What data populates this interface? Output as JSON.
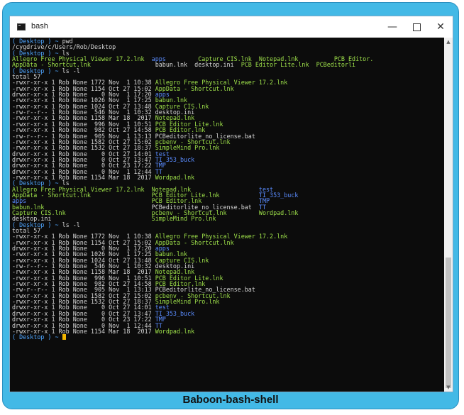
{
  "window": {
    "title": "bash",
    "minimize_glyph": "—",
    "close_glyph": "✕"
  },
  "icons": {
    "app_icon": "terminal-icon",
    "scroll_up": "chevron-up-icon",
    "scroll_down": "chevron-down-icon"
  },
  "scroll": {
    "up_glyph": "▲",
    "down_glyph": "▼",
    "position_fraction": 0.62
  },
  "caption": "Baboon-bash-shell",
  "colors": {
    "frame": "#43b9e6",
    "terminal_bg": "#0c0c0c",
    "prompt": "#4fa6ff",
    "executable": "#9fe24a",
    "directory": "#5a8cff",
    "text": "#d7d7d7",
    "cursor": "#f2b500"
  },
  "terminal": {
    "lines": [
      [
        {
          "t": "( Desktop ) ~ ",
          "c": "prompt"
        },
        {
          "t": "pwd",
          "c": "cmd"
        }
      ],
      [
        {
          "t": "/cygdrive/c/Users/Rob/Desktop",
          "c": "plain"
        }
      ],
      [
        {
          "t": "( Desktop ) ~ ",
          "c": "prompt"
        },
        {
          "t": "ls",
          "c": "cmd"
        }
      ],
      [
        {
          "t": "Allegro Free Physical Viewer 17.2.lnk  ",
          "c": "exe"
        },
        {
          "t": "apps         ",
          "c": "dir"
        },
        {
          "t": "Capture CIS.lnk  Notepad.lnk          PCB Editor.",
          "c": "exe"
        }
      ],
      [
        {
          "t": "AppData - Shortcut.lnk                  ",
          "c": "exe"
        },
        {
          "t": "babun.lnk  desktop.ini  ",
          "c": "plain"
        },
        {
          "t": "PCB Editor Lite.lnk  PCBeditorli",
          "c": "exe"
        }
      ],
      [
        {
          "t": "( Desktop ) ~ ",
          "c": "prompt"
        },
        {
          "t": "ls -l",
          "c": "cmd"
        }
      ],
      [
        {
          "t": "total 57",
          "c": "plain"
        }
      ],
      [
        {
          "t": "-rwxr-xr-x 1 Rob None 1772 Nov  1 10:38 ",
          "c": "plain"
        },
        {
          "t": "Allegro Free Physical Viewer 17.2.lnk",
          "c": "exe"
        }
      ],
      [
        {
          "t": "-rwxr-xr-x 1 Rob None 1154 Oct 27 15:02 ",
          "c": "plain"
        },
        {
          "t": "AppData - Shortcut.lnk",
          "c": "exe"
        }
      ],
      [
        {
          "t": "drwxr-xr-x 1 Rob None    0 Nov  1 17:20 ",
          "c": "plain"
        },
        {
          "t": "apps",
          "c": "dir"
        }
      ],
      [
        {
          "t": "-rwxr-xr-x 1 Rob None 1026 Nov  1 17:25 ",
          "c": "plain"
        },
        {
          "t": "babun.lnk",
          "c": "exe"
        }
      ],
      [
        {
          "t": "-rwxr-xr-x 1 Rob None 1024 Oct 27 13:48 ",
          "c": "plain"
        },
        {
          "t": "Capture CIS.lnk",
          "c": "exe"
        }
      ],
      [
        {
          "t": "-rw-r--r-- 1 Rob None  546 Nov  1 10:32 desktop.ini",
          "c": "plain"
        }
      ],
      [
        {
          "t": "-rwxr-xr-x 1 Rob None 1158 Mar 18  2017 ",
          "c": "plain"
        },
        {
          "t": "Notepad.lnk",
          "c": "exe"
        }
      ],
      [
        {
          "t": "-rwxr-xr-x 1 Rob None  996 Nov  1 10:51 ",
          "c": "plain"
        },
        {
          "t": "PCB Editor Lite.lnk",
          "c": "exe"
        }
      ],
      [
        {
          "t": "-rwxr-xr-x 1 Rob None  982 Oct 27 14:58 ",
          "c": "plain"
        },
        {
          "t": "PCB Editor.lnk",
          "c": "exe"
        }
      ],
      [
        {
          "t": "-rw-r--r-- 1 Rob None  905 Nov  1 13:13 PCBeditorlite_no_license.bat",
          "c": "plain"
        }
      ],
      [
        {
          "t": "-rwxr-xr-x 1 Rob None 1582 Oct 27 15:02 ",
          "c": "plain"
        },
        {
          "t": "pcbenv - Shortcut.lnk",
          "c": "exe"
        }
      ],
      [
        {
          "t": "-rwxr-xr-x 1 Rob None 1532 Oct 27 18:37 ",
          "c": "plain"
        },
        {
          "t": "SimpleMind Pro.lnk",
          "c": "exe"
        }
      ],
      [
        {
          "t": "drwxr-xr-x 1 Rob None    0 Oct 27 14:01 ",
          "c": "plain"
        },
        {
          "t": "test",
          "c": "dir"
        }
      ],
      [
        {
          "t": "drwxr-xr-x 1 Rob None    0 Oct 27 13:47 ",
          "c": "plain"
        },
        {
          "t": "TI_353_buck",
          "c": "dir"
        }
      ],
      [
        {
          "t": "drwxr-xr-x 1 Rob None    0 Oct 23 17:22 ",
          "c": "plain"
        },
        {
          "t": "TMP",
          "c": "dir"
        }
      ],
      [
        {
          "t": "drwxr-xr-x 1 Rob None    0 Nov  1 12:44 ",
          "c": "plain"
        },
        {
          "t": "TT",
          "c": "dir"
        }
      ],
      [
        {
          "t": "-rwxr-xr-x 1 Rob None 1154 Mar 18  2017 ",
          "c": "plain"
        },
        {
          "t": "Wordpad.lnk",
          "c": "exe"
        }
      ],
      [
        {
          "t": "( Desktop ) ~ ",
          "c": "prompt"
        },
        {
          "t": "ls",
          "c": "cmd"
        }
      ],
      [
        {
          "t": "Allegro Free Physical Viewer 17.2.lnk  Notepad.lnk                   ",
          "c": "exe"
        },
        {
          "t": "test",
          "c": "dir"
        }
      ],
      [
        {
          "t": "AppData - Shortcut.lnk                 PCB Editor Lite.lnk           ",
          "c": "exe"
        },
        {
          "t": "TI_353_buck",
          "c": "dir"
        }
      ],
      [
        {
          "t": "apps                                   ",
          "c": "dir"
        },
        {
          "t": "PCB Editor.lnk                ",
          "c": "exe"
        },
        {
          "t": "TMP",
          "c": "dir"
        }
      ],
      [
        {
          "t": "babun.lnk                              ",
          "c": "exe"
        },
        {
          "t": "PCBeditorlite_no_license.bat  ",
          "c": "plain"
        },
        {
          "t": "TT",
          "c": "dir"
        }
      ],
      [
        {
          "t": "Capture CIS.lnk                        pcbenv - Shortcut.lnk         Wordpad.lnk",
          "c": "exe"
        }
      ],
      [
        {
          "t": "desktop.ini                            ",
          "c": "plain"
        },
        {
          "t": "SimpleMind Pro.lnk",
          "c": "exe"
        }
      ],
      [
        {
          "t": "( Desktop ) ~ ",
          "c": "prompt"
        },
        {
          "t": "ls -l",
          "c": "cmd"
        }
      ],
      [
        {
          "t": "total 57",
          "c": "plain"
        }
      ],
      [
        {
          "t": "-rwxr-xr-x 1 Rob None 1772 Nov  1 10:38 ",
          "c": "plain"
        },
        {
          "t": "Allegro Free Physical Viewer 17.2.lnk",
          "c": "exe"
        }
      ],
      [
        {
          "t": "-rwxr-xr-x 1 Rob None 1154 Oct 27 15:02 ",
          "c": "plain"
        },
        {
          "t": "AppData - Shortcut.lnk",
          "c": "exe"
        }
      ],
      [
        {
          "t": "drwxr-xr-x 1 Rob None    0 Nov  1 17:20 ",
          "c": "plain"
        },
        {
          "t": "apps",
          "c": "dir"
        }
      ],
      [
        {
          "t": "-rwxr-xr-x 1 Rob None 1026 Nov  1 17:25 ",
          "c": "plain"
        },
        {
          "t": "babun.lnk",
          "c": "exe"
        }
      ],
      [
        {
          "t": "-rwxr-xr-x 1 Rob None 1024 Oct 27 13:48 ",
          "c": "plain"
        },
        {
          "t": "Capture CIS.lnk",
          "c": "exe"
        }
      ],
      [
        {
          "t": "-rw-r--r-- 1 Rob None  546 Nov  1 10:32 desktop.ini",
          "c": "plain"
        }
      ],
      [
        {
          "t": "-rwxr-xr-x 1 Rob None 1158 Mar 18  2017 ",
          "c": "plain"
        },
        {
          "t": "Notepad.lnk",
          "c": "exe"
        }
      ],
      [
        {
          "t": "-rwxr-xr-x 1 Rob None  996 Nov  1 10:51 ",
          "c": "plain"
        },
        {
          "t": "PCB Editor Lite.lnk",
          "c": "exe"
        }
      ],
      [
        {
          "t": "-rwxr-xr-x 1 Rob None  982 Oct 27 14:58 ",
          "c": "plain"
        },
        {
          "t": "PCB Editor.lnk",
          "c": "exe"
        }
      ],
      [
        {
          "t": "-rw-r--r-- 1 Rob None  905 Nov  1 13:13 PCBeditorlite_no_license.bat",
          "c": "plain"
        }
      ],
      [
        {
          "t": "-rwxr-xr-x 1 Rob None 1582 Oct 27 15:02 ",
          "c": "plain"
        },
        {
          "t": "pcbenv - Shortcut.lnk",
          "c": "exe"
        }
      ],
      [
        {
          "t": "-rwxr-xr-x 1 Rob None 1532 Oct 27 18:37 ",
          "c": "plain"
        },
        {
          "t": "SimpleMind Pro.lnk",
          "c": "exe"
        }
      ],
      [
        {
          "t": "drwxr-xr-x 1 Rob None    0 Oct 27 14:01 ",
          "c": "plain"
        },
        {
          "t": "test",
          "c": "dir"
        }
      ],
      [
        {
          "t": "drwxr-xr-x 1 Rob None    0 Oct 27 13:47 ",
          "c": "plain"
        },
        {
          "t": "TI_353_buck",
          "c": "dir"
        }
      ],
      [
        {
          "t": "drwxr-xr-x 1 Rob None    0 Oct 23 17:22 ",
          "c": "plain"
        },
        {
          "t": "TMP",
          "c": "dir"
        }
      ],
      [
        {
          "t": "drwxr-xr-x 1 Rob None    0 Nov  1 12:44 ",
          "c": "plain"
        },
        {
          "t": "TT",
          "c": "dir"
        }
      ],
      [
        {
          "t": "-rwxr-xr-x 1 Rob None 1154 Mar 18  2017 ",
          "c": "plain"
        },
        {
          "t": "Wordpad.lnk",
          "c": "exe"
        }
      ],
      [
        {
          "t": "( Desktop ) ~ ",
          "c": "prompt"
        }
      ]
    ]
  }
}
